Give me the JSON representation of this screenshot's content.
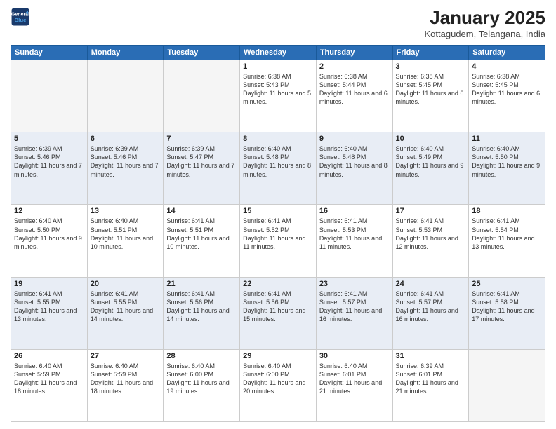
{
  "header": {
    "logo_line1": "General",
    "logo_line2": "Blue",
    "month": "January 2025",
    "location": "Kottagudem, Telangana, India"
  },
  "weekdays": [
    "Sunday",
    "Monday",
    "Tuesday",
    "Wednesday",
    "Thursday",
    "Friday",
    "Saturday"
  ],
  "weeks": [
    [
      {
        "day": "",
        "text": ""
      },
      {
        "day": "",
        "text": ""
      },
      {
        "day": "",
        "text": ""
      },
      {
        "day": "1",
        "text": "Sunrise: 6:38 AM\nSunset: 5:43 PM\nDaylight: 11 hours and 5 minutes."
      },
      {
        "day": "2",
        "text": "Sunrise: 6:38 AM\nSunset: 5:44 PM\nDaylight: 11 hours and 6 minutes."
      },
      {
        "day": "3",
        "text": "Sunrise: 6:38 AM\nSunset: 5:45 PM\nDaylight: 11 hours and 6 minutes."
      },
      {
        "day": "4",
        "text": "Sunrise: 6:38 AM\nSunset: 5:45 PM\nDaylight: 11 hours and 6 minutes."
      }
    ],
    [
      {
        "day": "5",
        "text": "Sunrise: 6:39 AM\nSunset: 5:46 PM\nDaylight: 11 hours and 7 minutes."
      },
      {
        "day": "6",
        "text": "Sunrise: 6:39 AM\nSunset: 5:46 PM\nDaylight: 11 hours and 7 minutes."
      },
      {
        "day": "7",
        "text": "Sunrise: 6:39 AM\nSunset: 5:47 PM\nDaylight: 11 hours and 7 minutes."
      },
      {
        "day": "8",
        "text": "Sunrise: 6:40 AM\nSunset: 5:48 PM\nDaylight: 11 hours and 8 minutes."
      },
      {
        "day": "9",
        "text": "Sunrise: 6:40 AM\nSunset: 5:48 PM\nDaylight: 11 hours and 8 minutes."
      },
      {
        "day": "10",
        "text": "Sunrise: 6:40 AM\nSunset: 5:49 PM\nDaylight: 11 hours and 9 minutes."
      },
      {
        "day": "11",
        "text": "Sunrise: 6:40 AM\nSunset: 5:50 PM\nDaylight: 11 hours and 9 minutes."
      }
    ],
    [
      {
        "day": "12",
        "text": "Sunrise: 6:40 AM\nSunset: 5:50 PM\nDaylight: 11 hours and 9 minutes."
      },
      {
        "day": "13",
        "text": "Sunrise: 6:40 AM\nSunset: 5:51 PM\nDaylight: 11 hours and 10 minutes."
      },
      {
        "day": "14",
        "text": "Sunrise: 6:41 AM\nSunset: 5:51 PM\nDaylight: 11 hours and 10 minutes."
      },
      {
        "day": "15",
        "text": "Sunrise: 6:41 AM\nSunset: 5:52 PM\nDaylight: 11 hours and 11 minutes."
      },
      {
        "day": "16",
        "text": "Sunrise: 6:41 AM\nSunset: 5:53 PM\nDaylight: 11 hours and 11 minutes."
      },
      {
        "day": "17",
        "text": "Sunrise: 6:41 AM\nSunset: 5:53 PM\nDaylight: 11 hours and 12 minutes."
      },
      {
        "day": "18",
        "text": "Sunrise: 6:41 AM\nSunset: 5:54 PM\nDaylight: 11 hours and 13 minutes."
      }
    ],
    [
      {
        "day": "19",
        "text": "Sunrise: 6:41 AM\nSunset: 5:55 PM\nDaylight: 11 hours and 13 minutes."
      },
      {
        "day": "20",
        "text": "Sunrise: 6:41 AM\nSunset: 5:55 PM\nDaylight: 11 hours and 14 minutes."
      },
      {
        "day": "21",
        "text": "Sunrise: 6:41 AM\nSunset: 5:56 PM\nDaylight: 11 hours and 14 minutes."
      },
      {
        "day": "22",
        "text": "Sunrise: 6:41 AM\nSunset: 5:56 PM\nDaylight: 11 hours and 15 minutes."
      },
      {
        "day": "23",
        "text": "Sunrise: 6:41 AM\nSunset: 5:57 PM\nDaylight: 11 hours and 16 minutes."
      },
      {
        "day": "24",
        "text": "Sunrise: 6:41 AM\nSunset: 5:57 PM\nDaylight: 11 hours and 16 minutes."
      },
      {
        "day": "25",
        "text": "Sunrise: 6:41 AM\nSunset: 5:58 PM\nDaylight: 11 hours and 17 minutes."
      }
    ],
    [
      {
        "day": "26",
        "text": "Sunrise: 6:40 AM\nSunset: 5:59 PM\nDaylight: 11 hours and 18 minutes."
      },
      {
        "day": "27",
        "text": "Sunrise: 6:40 AM\nSunset: 5:59 PM\nDaylight: 11 hours and 18 minutes."
      },
      {
        "day": "28",
        "text": "Sunrise: 6:40 AM\nSunset: 6:00 PM\nDaylight: 11 hours and 19 minutes."
      },
      {
        "day": "29",
        "text": "Sunrise: 6:40 AM\nSunset: 6:00 PM\nDaylight: 11 hours and 20 minutes."
      },
      {
        "day": "30",
        "text": "Sunrise: 6:40 AM\nSunset: 6:01 PM\nDaylight: 11 hours and 21 minutes."
      },
      {
        "day": "31",
        "text": "Sunrise: 6:39 AM\nSunset: 6:01 PM\nDaylight: 11 hours and 21 minutes."
      },
      {
        "day": "",
        "text": ""
      }
    ]
  ]
}
